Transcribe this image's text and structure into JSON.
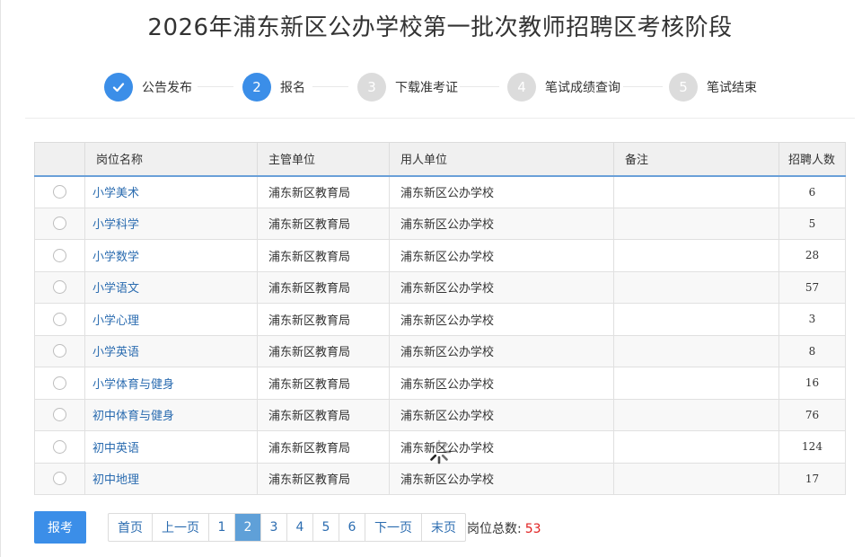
{
  "page": {
    "title": "2026年浦东新区公办学校第一批次教师招聘区考核阶段"
  },
  "colors": {
    "accent": "#3b8ee8",
    "pending": "#dcdcdc",
    "link": "#2b6cb0",
    "count": "#e02020"
  },
  "steps": [
    {
      "label": "公告发布",
      "number": "1",
      "state": "done",
      "icon": "check-icon"
    },
    {
      "label": "报名",
      "number": "2",
      "state": "active"
    },
    {
      "label": "下载准考证",
      "number": "3",
      "state": "pending"
    },
    {
      "label": "笔试成绩查询",
      "number": "4",
      "state": "pending"
    },
    {
      "label": "笔试结束",
      "number": "5",
      "state": "pending"
    }
  ],
  "table": {
    "headers": [
      "",
      "岗位名称",
      "主管单位",
      "用人单位",
      "备注",
      "招聘人数"
    ],
    "rows": [
      {
        "name": "小学美术",
        "authority": "浦东新区教育局",
        "employer": "浦东新区公办学校",
        "note": "",
        "count": "6"
      },
      {
        "name": "小学科学",
        "authority": "浦东新区教育局",
        "employer": "浦东新区公办学校",
        "note": "",
        "count": "5"
      },
      {
        "name": "小学数学",
        "authority": "浦东新区教育局",
        "employer": "浦东新区公办学校",
        "note": "",
        "count": "28"
      },
      {
        "name": "小学语文",
        "authority": "浦东新区教育局",
        "employer": "浦东新区公办学校",
        "note": "",
        "count": "57"
      },
      {
        "name": "小学心理",
        "authority": "浦东新区教育局",
        "employer": "浦东新区公办学校",
        "note": "",
        "count": "3"
      },
      {
        "name": "小学英语",
        "authority": "浦东新区教育局",
        "employer": "浦东新区公办学校",
        "note": "",
        "count": "8"
      },
      {
        "name": "小学体育与健身",
        "authority": "浦东新区教育局",
        "employer": "浦东新区公办学校",
        "note": "",
        "count": "16"
      },
      {
        "name": "初中体育与健身",
        "authority": "浦东新区教育局",
        "employer": "浦东新区公办学校",
        "note": "",
        "count": "76"
      },
      {
        "name": "初中英语",
        "authority": "浦东新区教育局",
        "employer": "浦东新区公办学校",
        "note": "",
        "count": "124"
      },
      {
        "name": "初中地理",
        "authority": "浦东新区教育局",
        "employer": "浦东新区公办学校",
        "note": "",
        "count": "17"
      }
    ]
  },
  "actions": {
    "apply_label": "报考"
  },
  "pagination": {
    "first": "首页",
    "prev": "上一页",
    "pages": [
      "1",
      "2",
      "3",
      "4",
      "5",
      "6"
    ],
    "current": "2",
    "next": "下一页",
    "last": "末页"
  },
  "summary": {
    "total_label": "岗位总数:",
    "total_value": "53"
  },
  "loading_icon": "spinner-icon"
}
